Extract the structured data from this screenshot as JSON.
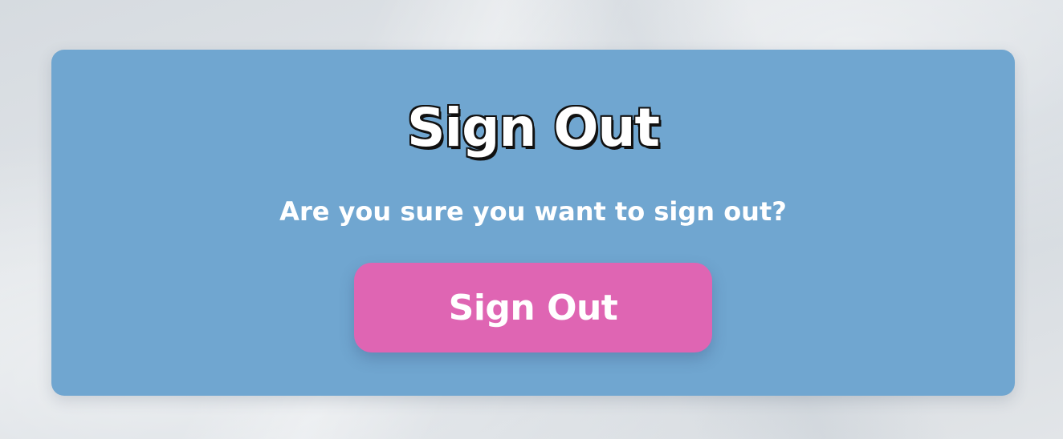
{
  "dialog": {
    "title": "Sign Out",
    "message": "Are you sure you want to sign out?",
    "button_label": "Sign Out"
  },
  "colors": {
    "card_background": "#70a6d0",
    "button_background": "#df65b3",
    "text": "#ffffff",
    "title_outline": "#111111"
  }
}
